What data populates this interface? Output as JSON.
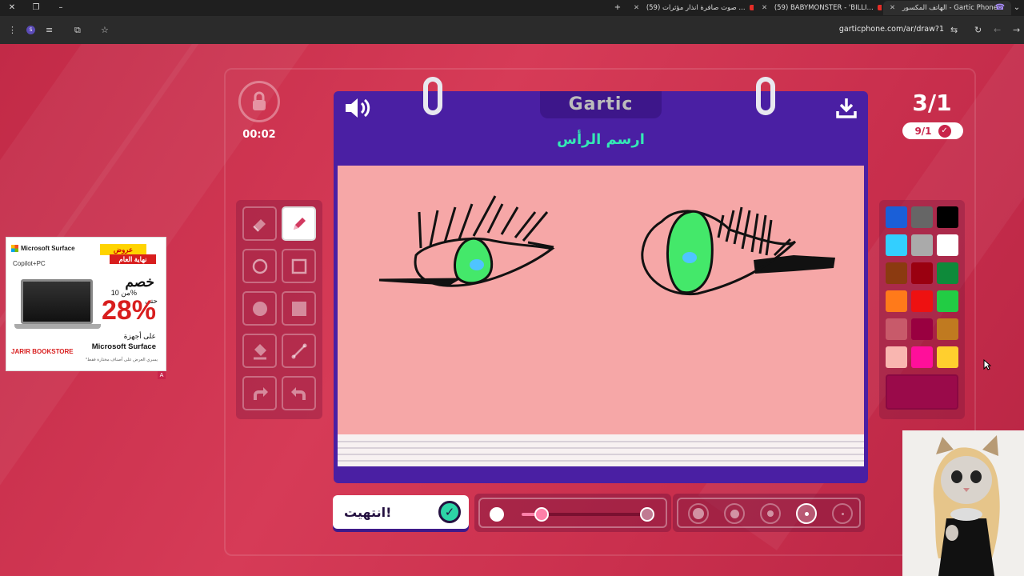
{
  "browser": {
    "tabs": [
      {
        "title": "الهاتف المكسور - Gartic Phone",
        "active": true
      },
      {
        "title": "(59) BABYMONSTER - 'BILLI...",
        "active": false
      },
      {
        "title": "(59) صوت صافرة انذار مؤثرات ...",
        "active": false
      }
    ],
    "url": "garticphone.com/ar/draw?1",
    "profile_initial": "S"
  },
  "game": {
    "logo": "Gartic",
    "prompt": "ارسم الرأس",
    "timer": "00:02",
    "round": "3/1",
    "players_done": "9/1",
    "done_button": "انتهيت!",
    "tools": [
      "eraser-icon",
      "pencil-icon",
      "circle-outline-icon",
      "square-outline-icon",
      "circle-fill-icon",
      "square-fill-icon",
      "bucket-icon",
      "line-icon",
      "redo-icon",
      "undo-icon"
    ],
    "selected_tool": "pencil-icon",
    "palette": [
      "#1a5fd8",
      "#666666",
      "#000000",
      "#33cfff",
      "#aaaaaa",
      "#ffffff",
      "#8b3a10",
      "#9a0010",
      "#0e8a3a",
      "#ff7a1a",
      "#ee1111",
      "#22cc44",
      "#c85a6a",
      "#990040",
      "#c07a20",
      "#f9b6b0",
      "#ff0f9a",
      "#ffcf2e"
    ],
    "current_color": "#9a0a4a",
    "canvas_color": "#f6a7a7",
    "opacity_level": 0.15,
    "brush_sizes": [
      "xl",
      "l",
      "m",
      "s",
      "xs"
    ],
    "selected_brush": "s"
  },
  "ad": {
    "brand": "Microsoft Surface",
    "copilot": "Copilot+PC",
    "offer_line1": "عروض",
    "offer_line2": "نهاية العام",
    "discount": "خصم",
    "from": "من 10%",
    "upto": "حتى",
    "percent": "28%",
    "on_devices": "على أجهزة",
    "product": "Microsoft Surface",
    "store": "JARIR BOOKSTORE",
    "fine_print": "*يسري العرض على أصناف مختارة فقط"
  }
}
